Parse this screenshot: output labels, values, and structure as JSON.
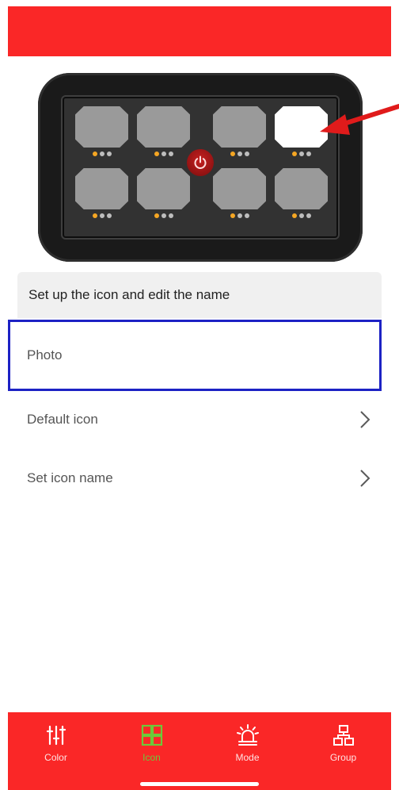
{
  "device": {
    "keys": [
      {
        "selected": false,
        "active_dot": 0
      },
      {
        "selected": false,
        "active_dot": 0
      },
      {
        "selected": false,
        "active_dot": 0
      },
      {
        "selected": true,
        "active_dot": 0
      },
      {
        "selected": false,
        "active_dot": 0
      },
      {
        "selected": false,
        "active_dot": 0
      },
      {
        "selected": false,
        "active_dot": 0
      },
      {
        "selected": false,
        "active_dot": 0
      }
    ],
    "power_icon": "power-icon",
    "pointer_icon": "red-arrow-icon"
  },
  "settings": {
    "header": "Set up the icon and edit the name",
    "photo_label": "Photo",
    "default_icon_label": "Default icon",
    "set_icon_name_label": "Set icon name"
  },
  "tabs": [
    {
      "label": "Color",
      "icon": "sliders-icon",
      "active": false
    },
    {
      "label": "Icon",
      "icon": "grid-icon",
      "active": true
    },
    {
      "label": "Mode",
      "icon": "siren-icon",
      "active": false
    },
    {
      "label": "Group",
      "icon": "network-icon",
      "active": false
    }
  ],
  "colors": {
    "brand_red": "#fa2727",
    "active_tab": "#6cc93a",
    "highlight_border": "#1d22c4",
    "indicator_dot": "#f5a623"
  }
}
